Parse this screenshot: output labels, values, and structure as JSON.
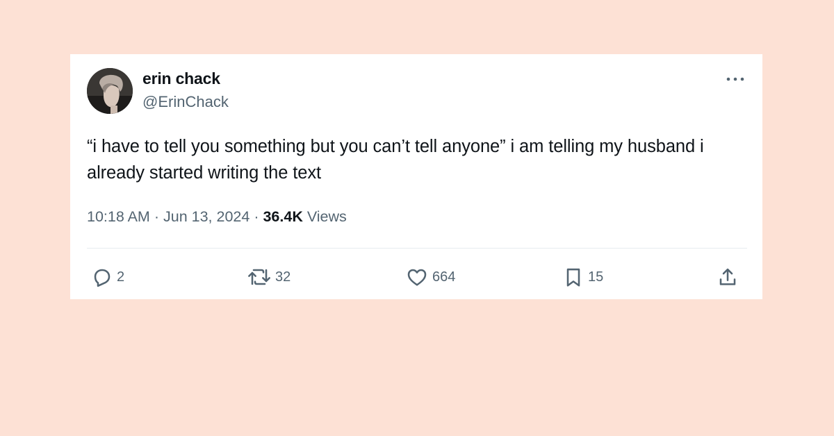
{
  "page": {
    "background_color": "#fde1d5"
  },
  "tweet": {
    "author": {
      "display_name": "erin chack",
      "handle": "@ErinChack"
    },
    "text": "“i have to tell you something but you can’t tell anyone” i am telling my husband i already started writing the text",
    "time": "10:18 AM",
    "date": "Jun 13, 2024",
    "separator": "·",
    "views_count": "36.4K",
    "views_label": "Views",
    "actions": {
      "replies": {
        "icon": "reply-icon",
        "count": "2"
      },
      "reposts": {
        "icon": "repost-icon",
        "count": "32"
      },
      "likes": {
        "icon": "heart-icon",
        "count": "664"
      },
      "bookmarks": {
        "icon": "bookmark-icon",
        "count": "15"
      },
      "share": {
        "icon": "share-icon"
      }
    },
    "more_icon": "more-options-icon"
  },
  "colors": {
    "text_primary": "#0f1419",
    "text_secondary": "#536471",
    "divider": "#e6ecf0"
  }
}
